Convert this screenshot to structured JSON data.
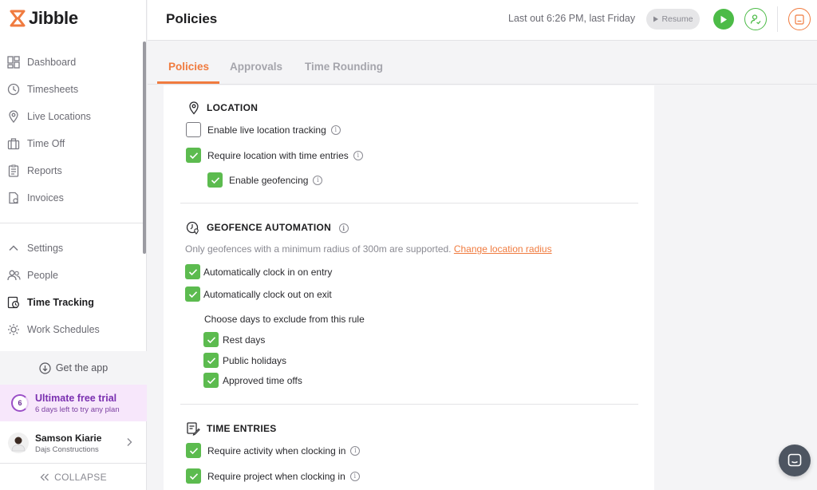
{
  "app": {
    "name": "Jibble"
  },
  "sidebar": {
    "items": [
      {
        "label": "Dashboard",
        "icon": "dashboard-icon"
      },
      {
        "label": "Timesheets",
        "icon": "clock-icon"
      },
      {
        "label": "Live Locations",
        "icon": "location-pin-icon"
      },
      {
        "label": "Time Off",
        "icon": "luggage-icon"
      },
      {
        "label": "Reports",
        "icon": "report-icon"
      },
      {
        "label": "Invoices",
        "icon": "invoice-icon"
      }
    ],
    "settings": {
      "label": "Settings",
      "items": [
        {
          "label": "People",
          "icon": "people-icon"
        },
        {
          "label": "Time Tracking",
          "icon": "time-tracking-icon",
          "active": true
        },
        {
          "label": "Work Schedules",
          "icon": "schedule-icon"
        }
      ]
    },
    "get_app": "Get the app",
    "trial": {
      "days": "6",
      "title": "Ultimate free trial",
      "subtitle": "6 days left to try any plan"
    },
    "user": {
      "name": "Samson Kiarie",
      "org": "Dajs Constructions"
    },
    "collapse": "COLLAPSE"
  },
  "header": {
    "title": "Policies",
    "last_out": "Last out 6:26 PM, last Friday",
    "resume": "Resume"
  },
  "tabs": [
    {
      "label": "Policies",
      "active": true
    },
    {
      "label": "Approvals",
      "active": false
    },
    {
      "label": "Time Rounding",
      "active": false
    }
  ],
  "location": {
    "title": "LOCATION",
    "live_tracking": {
      "label": "Enable live location tracking",
      "checked": false
    },
    "require_location": {
      "label": "Require location with time entries",
      "checked": true
    },
    "geofencing": {
      "label": "Enable geofencing",
      "checked": true
    }
  },
  "geofence": {
    "title": "GEOFENCE AUTOMATION",
    "note": "Only geofences with a minimum radius of 300m are supported.",
    "note_link": "Change location radius",
    "clock_in": {
      "label": "Automatically clock in on entry",
      "checked": true
    },
    "clock_out": {
      "label": "Automatically clock out on exit",
      "checked": true
    },
    "exclude_heading": "Choose days to exclude from this rule",
    "rest_days": {
      "label": "Rest days",
      "checked": true
    },
    "public_holidays": {
      "label": "Public holidays",
      "checked": true
    },
    "approved_time_offs": {
      "label": "Approved time offs",
      "checked": true
    }
  },
  "time_entries": {
    "title": "TIME ENTRIES",
    "require_activity": {
      "label": "Require activity when clocking in",
      "checked": true
    },
    "require_project": {
      "label": "Require project when clocking in",
      "checked": true
    }
  },
  "colors": {
    "accent": "#f07b3f",
    "check": "#5cbb4f",
    "play": "#4cbb47",
    "trial": "#7a2fb0"
  }
}
